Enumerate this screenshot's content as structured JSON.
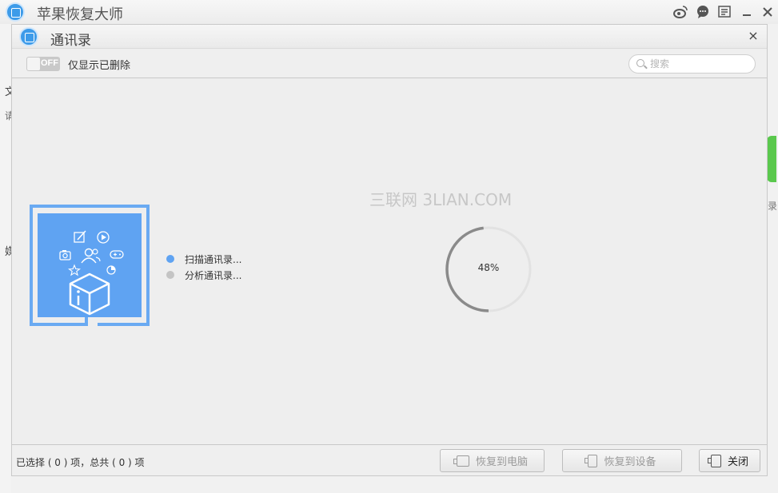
{
  "app": {
    "title": "苹果恢复大师",
    "titlebar_icons": [
      "weibo-icon",
      "chat-icon",
      "menu-icon",
      "minimize-icon",
      "close-icon"
    ]
  },
  "background": {
    "text_1": "文",
    "text_2": "请",
    "text_3": "媒",
    "text_4": "录",
    "accent_color": "#5ac84d"
  },
  "dialog": {
    "title": "通讯录",
    "close_glyph": "×",
    "toggle": {
      "state": "OFF",
      "label": "仅显示已删除"
    },
    "search": {
      "placeholder": "搜索",
      "value": ""
    },
    "watermark": "三联网 3LIAN.COM",
    "status_items": [
      {
        "label": "扫描通讯录...",
        "color": "#5fa3f2"
      },
      {
        "label": "分析通讯录...",
        "color": "#c4c4c4"
      }
    ],
    "progress": {
      "percent": 48,
      "label": "48%"
    },
    "footer": {
      "selection_text": "已选择 ( 0 ) 项，总共 ( 0 ) 项",
      "restore_pc": "恢复到电脑",
      "restore_device": "恢复到设备",
      "close": "关闭"
    }
  },
  "colors": {
    "brand_blue": "#3d9be9",
    "illustration_blue": "#5fa3f2"
  }
}
